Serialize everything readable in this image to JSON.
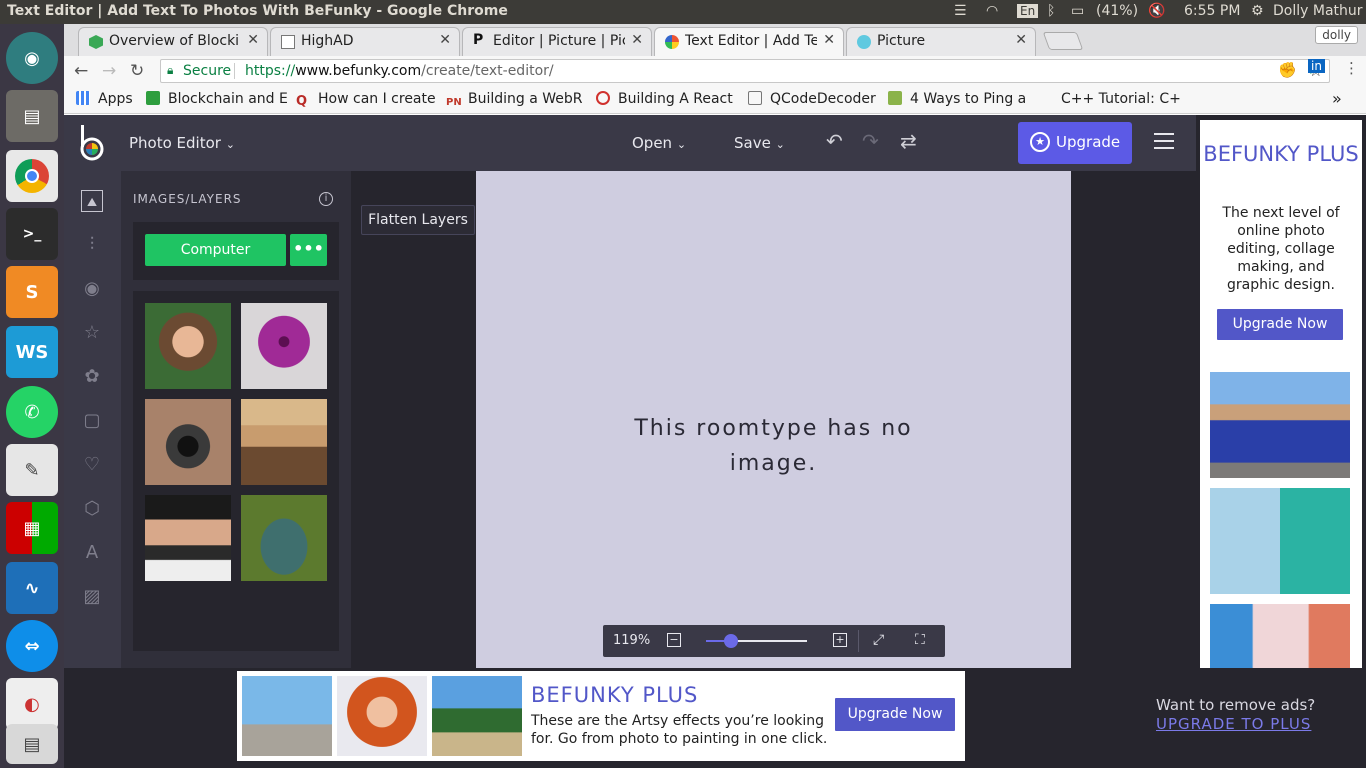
{
  "os": {
    "window_title": "Text Editor | Add Text To Photos With BeFunky - Google Chrome",
    "keyboard": "En",
    "battery": "(41%)",
    "time": "6:55 PM",
    "user": "Dolly Mathur"
  },
  "launcher": [
    "ubuntu-icon",
    "files-icon",
    "chrome-icon",
    "terminal-icon",
    "sublime-icon",
    "webstorm-icon",
    "whatsapp-icon",
    "text-editor-icon",
    "app-grid-icon",
    "system-monitor-icon",
    "teamviewer-icon",
    "libreoffice-icon",
    "document-icon"
  ],
  "browser": {
    "tabs": [
      {
        "label": "Overview of Blocki",
        "icon": "hexagon-icon",
        "active": false
      },
      {
        "label": "HighAD",
        "icon": "page-icon",
        "active": false
      },
      {
        "label": "Editor | Picture | Pic",
        "icon": "pinterest-icon",
        "active": false
      },
      {
        "label": "Text Editor | Add Te",
        "icon": "befunky-icon",
        "active": true
      },
      {
        "label": "Picture",
        "icon": "globe-icon",
        "active": false
      }
    ],
    "profile": "dolly",
    "secure_label": "Secure",
    "url_scheme": "https://",
    "url_domain": "www.befunky.com",
    "url_path": "/create/text-editor/",
    "bookmarks": [
      {
        "label": "Apps",
        "icon": "apps-icon",
        "color": "#4285f4"
      },
      {
        "label": "Blockchain and E",
        "icon": "ftu-icon",
        "color": "#2e9e3e"
      },
      {
        "label": "How can I create",
        "icon": "quora-icon",
        "color": "#b92b27"
      },
      {
        "label": "Building a WebR",
        "icon": "pn-icon",
        "color": "#c0392b"
      },
      {
        "label": "Building A React",
        "icon": "dribbble-icon",
        "color": "#d0312d"
      },
      {
        "label": "QCodeDecoder",
        "icon": "page-icon",
        "color": "#ffffff"
      },
      {
        "label": "4 Ways to Ping a",
        "icon": "wikihow-icon",
        "color": "#8bb34a"
      },
      {
        "label": "C++ Tutorial: C+",
        "icon": "blank-icon",
        "color": "#ffffff"
      }
    ],
    "more": "»"
  },
  "app": {
    "photo_editor": "Photo Editor",
    "open": "Open",
    "save": "Save",
    "upgrade": "Upgrade",
    "panel_title": "IMAGES/LAYERS",
    "computer_btn": "Computer",
    "more_btn": "•••",
    "flatten": "Flatten Layers",
    "canvas_msg_line1": "This roomtype has no",
    "canvas_msg_line2": "image.",
    "zoom": "119%",
    "zoom_level": 0.25,
    "sidebar_tools": [
      "image-icon",
      "adjust-icon",
      "eye-icon",
      "star-icon",
      "flower-icon",
      "frame-icon",
      "heart-icon",
      "sticker-icon",
      "text-icon",
      "texture-icon"
    ],
    "thumbnails": [
      "woman-portrait",
      "purple-succulent",
      "vintage-camera",
      "smiling-woman-hat",
      "woman-black-hat",
      "vintage-truck"
    ]
  },
  "ad_right": {
    "title": "BEFUNKY PLUS",
    "desc": "The next level of online photo editing, collage making, and graphic design.",
    "button": "Upgrade Now"
  },
  "ad_bottom": {
    "title": "BEFUNKY PLUS",
    "desc": "These are the Artsy effects you’re looking for. Go from photo to painting in one click.",
    "button": "Upgrade Now",
    "remove_question": "Want to remove ads?",
    "remove_link": "UPGRADE TO PLUS"
  },
  "colors": {
    "accent": "#5c5ae6",
    "green": "#1fc463",
    "header": "#3a3947"
  }
}
